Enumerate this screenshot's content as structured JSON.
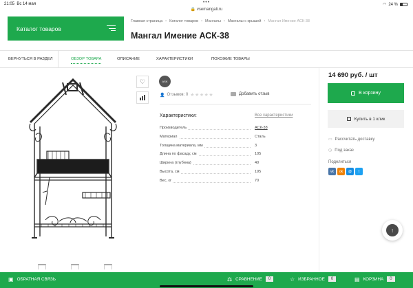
{
  "statusbar": {
    "time": "21:05",
    "date": "Вс 14 мая",
    "url": "vsemangali.ru",
    "battery": "24 %"
  },
  "catalog": {
    "label": "Каталог товаров"
  },
  "breadcrumbs": [
    "Главная страница",
    "Каталог товаров",
    "Мангалы",
    "Мангалы с крышей",
    "Мангал Имение АСК-38"
  ],
  "title": "Мангал Имение АСК-38",
  "tabs": [
    "Вернуться в раздел",
    "Обзор товара",
    "Описание",
    "Характеристики",
    "Похожие товары"
  ],
  "brand_logo_text": "ASK",
  "reviews": {
    "label": "Отзывов: 0",
    "leave": "Добавить отзыв"
  },
  "characteristics": {
    "title": "Характеристики:",
    "all_link": "Все характеристики",
    "rows": [
      {
        "k": "Производитель",
        "v": "АСК-38"
      },
      {
        "k": "Материал",
        "v": "Сталь"
      },
      {
        "k": "Толщина материала, мм",
        "v": "3"
      },
      {
        "k": "Длина по фасаду, см",
        "v": "105"
      },
      {
        "k": "Ширина (глубина)",
        "v": "40"
      },
      {
        "k": "Высота, см",
        "v": "195"
      },
      {
        "k": "Вес, кг",
        "v": "70"
      }
    ]
  },
  "buy": {
    "price": "14 690 руб. / шт",
    "cart": "В корзину",
    "oneclick": "Купить в 1 клик",
    "delivery": "Рассчитать доставку",
    "order": "Под заказ",
    "share": "Поделиться"
  },
  "share_icons": [
    {
      "name": "vk-icon",
      "glyph": "vk",
      "color": "#4a76a8"
    },
    {
      "name": "odnoklassniki-icon",
      "glyph": "ok",
      "color": "#ee8208"
    },
    {
      "name": "mail-icon",
      "glyph": "@",
      "color": "#168de2"
    },
    {
      "name": "twitter-icon",
      "glyph": "t",
      "color": "#1da1f2"
    }
  ],
  "bottom": {
    "feedback": "Обратная связь",
    "compare": "Сравнение",
    "compare_count": "0",
    "favorites": "Избранное",
    "favorites_count": "0",
    "cart": "Корзина",
    "cart_count": "0"
  },
  "colors": {
    "accent": "#1ea94d"
  }
}
